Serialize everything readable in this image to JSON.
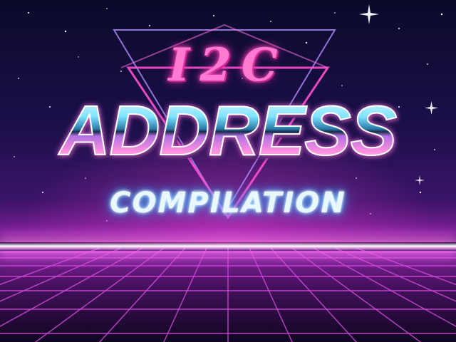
{
  "title": {
    "line1": "I2C",
    "line2": "ADDRESS",
    "line3": "COMPILATION"
  },
  "colors": {
    "sky_top": "#0b0a2a",
    "sky_mid": "#3a1468",
    "glow_pink": "#ff4fc3",
    "neon_blue": "#57c8ff",
    "grid_magenta": "#d84be0"
  }
}
